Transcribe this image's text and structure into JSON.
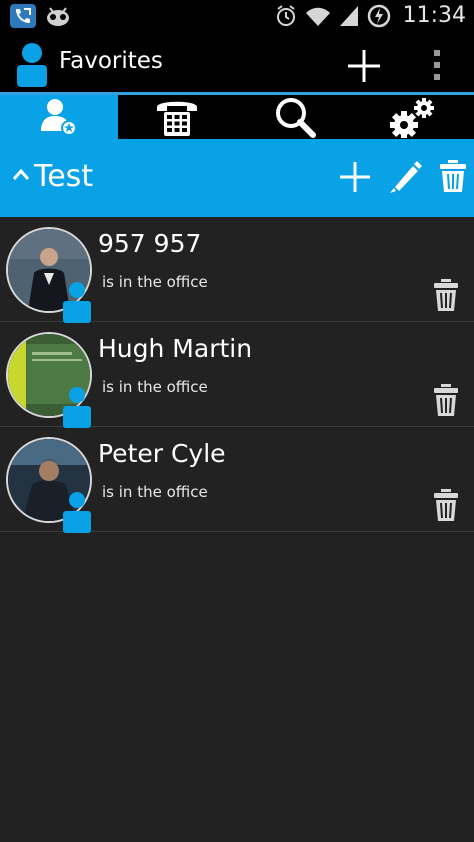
{
  "status_bar": {
    "time": "11:34"
  },
  "action_bar": {
    "title": "Favorites"
  },
  "tabs": [
    {
      "icon": "favorites-contact-icon",
      "active": true
    },
    {
      "icon": "dialpad-phone-icon",
      "active": false
    },
    {
      "icon": "search-icon",
      "active": false
    },
    {
      "icon": "settings-gears-icon",
      "active": false
    }
  ],
  "group": {
    "title": "Test"
  },
  "contacts": [
    {
      "name": "957 957",
      "status": "is in the office",
      "avatar_colors": [
        "#3d4d5a",
        "#1c2028",
        "#8f7d6b"
      ]
    },
    {
      "name": "Hugh Martin",
      "status": "is in the office",
      "avatar_colors": [
        "#c8d630",
        "#4f7a3a",
        "#2a3d2a"
      ]
    },
    {
      "name": "Peter Cyle",
      "status": "is in the office",
      "avatar_colors": [
        "#4a6a84",
        "#1f2a35",
        "#9a7a60"
      ]
    }
  ],
  "colors": {
    "accent": "#0aa2e6",
    "background": "#222222",
    "bar": "#000000"
  }
}
